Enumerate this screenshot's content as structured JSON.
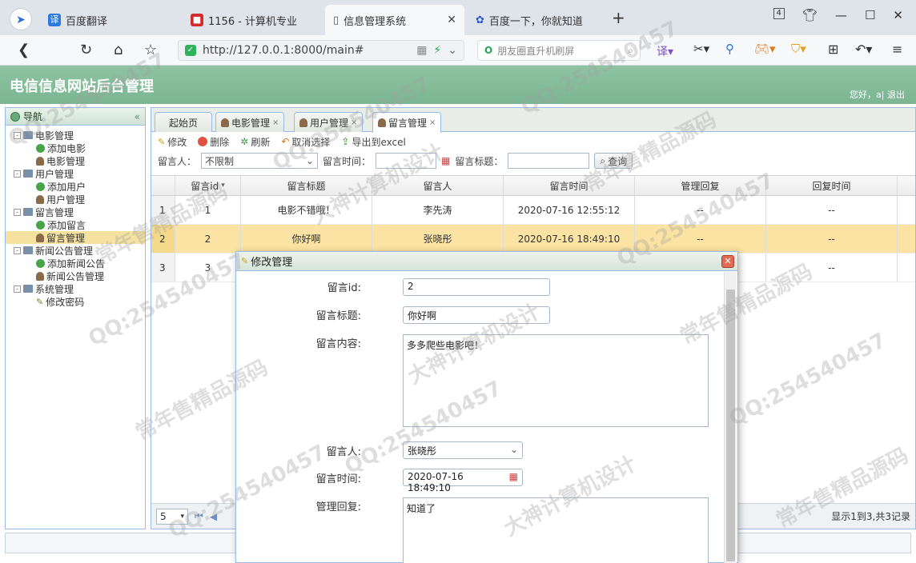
{
  "browser": {
    "tabs": [
      {
        "label": "百度翻译",
        "icon": "translate-icon"
      },
      {
        "label": "1156 - 计算机专业",
        "icon": "site-icon"
      },
      {
        "label": "信息管理系统",
        "icon": "page-icon"
      },
      {
        "label": "百度一下，你就知道",
        "icon": "baidu-icon"
      }
    ],
    "tab_count": "4",
    "url": "http://127.0.0.1:8000/main#",
    "search_placeholder": "朋友圈直升机刷屏"
  },
  "app": {
    "title": "电信信息网站后台管理",
    "user_text": "您好，a| 退出"
  },
  "nav": {
    "header": "导航",
    "tree": [
      {
        "label": "电影管理",
        "level": 0
      },
      {
        "label": "添加电影",
        "level": 1
      },
      {
        "label": "电影管理",
        "level": 1
      },
      {
        "label": "用户管理",
        "level": 0
      },
      {
        "label": "添加用户",
        "level": 1
      },
      {
        "label": "用户管理",
        "level": 1
      },
      {
        "label": "留言管理",
        "level": 0
      },
      {
        "label": "添加留言",
        "level": 1
      },
      {
        "label": "留言管理",
        "level": 1
      },
      {
        "label": "新闻公告管理",
        "level": 0
      },
      {
        "label": "添加新闻公告",
        "level": 1
      },
      {
        "label": "新闻公告管理",
        "level": 1
      },
      {
        "label": "系统管理",
        "level": 0
      },
      {
        "label": "修改密码",
        "level": 1
      }
    ]
  },
  "content_tabs": [
    "起始页",
    "电影管理",
    "用户管理",
    "留言管理"
  ],
  "toolbar": {
    "edit": "修改",
    "delete": "删除",
    "refresh": "刷新",
    "cancel_select": "取消选择",
    "export": "导出到excel"
  },
  "filter": {
    "person_label": "留言人：",
    "person_value": "不限制",
    "time_label": "留言时间：",
    "title_label": "留言标题：",
    "query": "查询"
  },
  "grid": {
    "columns": [
      "留言id",
      "留言标题",
      "留言人",
      "留言时间",
      "管理回复",
      "回复时间"
    ],
    "rows": [
      {
        "n": "1",
        "id": "1",
        "title": "电影不错哦！",
        "person": "李先涛",
        "time": "2020-07-16 12:55:12",
        "reply": "--",
        "reply_time": "--"
      },
      {
        "n": "2",
        "id": "2",
        "title": "你好啊",
        "person": "张晓彤",
        "time": "2020-07-16 18:49:10",
        "reply": "--",
        "reply_time": "--"
      },
      {
        "n": "3",
        "id": "3",
        "title": "",
        "person": "",
        "time": "",
        "reply": "",
        "reply_time": "--"
      }
    ],
    "page_size": "5",
    "page_info": "显示1到3,共3记录"
  },
  "dialog": {
    "title": "修改管理",
    "labels": {
      "id": "留言id:",
      "title": "留言标题:",
      "content": "留言内容:",
      "person": "留言人:",
      "time": "留言时间:",
      "reply": "管理回复:"
    },
    "values": {
      "id": "2",
      "title": "你好啊",
      "content": "多多爬些电影吧！",
      "person": "张晓彤",
      "time": "2020-07-16 18:49:10",
      "reply": "知道了"
    }
  },
  "watermarks": [
    "QQ:254540457",
    "常年售精品源码",
    "大神计算机设计"
  ],
  "colors": {
    "banner": "#7bb592",
    "highlight_row": "#fbe3a3",
    "border": "#99bbe8"
  }
}
